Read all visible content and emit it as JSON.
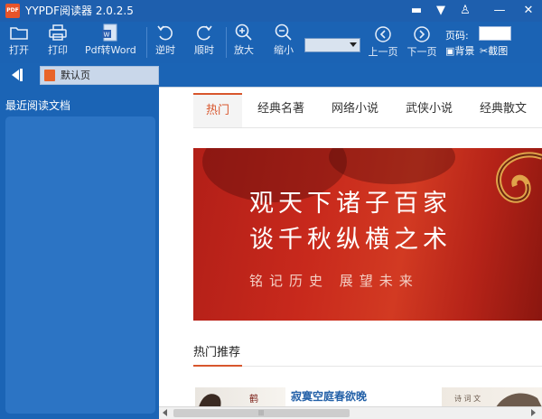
{
  "window": {
    "title": "YYPDF阅读器 2.0.2.5",
    "logo_text": "PDF",
    "controls": [
      "▬",
      "▼",
      "♙",
      "—",
      "✕"
    ]
  },
  "toolbar": {
    "open": "打开",
    "print": "打印",
    "pdf_to_word": "Pdf转Word",
    "rotate_ccw": "逆时",
    "rotate_cw": "顺时",
    "zoom_in": "放大",
    "zoom_out": "缩小",
    "prev_page": "上一页",
    "next_page": "下一页",
    "page_label": "页码:",
    "background": "背景",
    "screenshot": "截图"
  },
  "tabbar": {
    "doc_tab": "默认页"
  },
  "sidebar": {
    "title": "最近阅读文档"
  },
  "content": {
    "tabs": [
      "热门",
      "经典名著",
      "网络小说",
      "武侠小说",
      "经典散文"
    ],
    "active_tab": 0,
    "banner": {
      "line1": "观天下诸子百家",
      "line2": "谈千秋纵横之术",
      "line3": "铭记历史 展望未来"
    },
    "section_title": "热门推荐",
    "recommend_title": "寂寞空庭春欲晚"
  },
  "colors": {
    "chrome_blue": "#1b64b5",
    "accent_orange": "#d8562d",
    "banner_red": "#c8291c"
  }
}
